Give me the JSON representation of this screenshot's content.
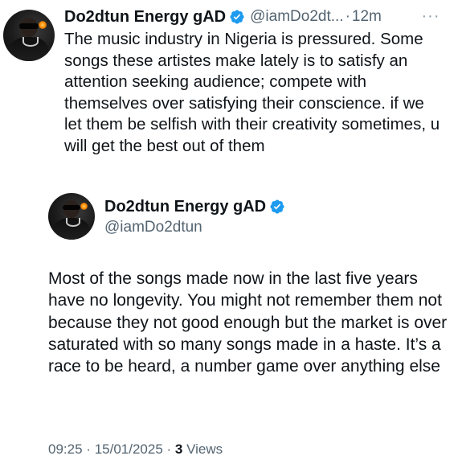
{
  "tweet": {
    "author_name": "Do2dtun Energy gAD",
    "handle": "@iamDo2dt...",
    "separator": "·",
    "time_ago": "12m",
    "more_label": "···",
    "body": "The music industry in Nigeria is pressured. Some songs these artistes make lately is to satisfy an attention seeking audience; compete with themselves over satisfying their conscience. if we let them be selfish with their creativity sometimes, u will get the best out of them"
  },
  "quoted": {
    "author_name": "Do2dtun Energy gAD",
    "handle": "@iamDo2dtun",
    "body": "Most of the songs made now in the last five years have no longevity. You might not remember them not because they not good enough but the market is over saturated with so many songs made in a haste. It’s a race to be heard, a number game over anything else"
  },
  "meta": {
    "time": "09:25",
    "separator": "·",
    "date": "15/01/2025",
    "views_count": "3",
    "views_label": "Views"
  },
  "colors": {
    "verified_blue": "#1d9bf0",
    "secondary_text": "#536471",
    "primary_text": "#0f1419"
  }
}
